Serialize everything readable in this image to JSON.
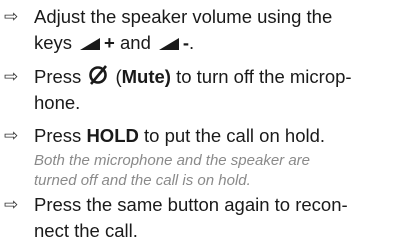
{
  "steps": [
    {
      "arrow": "⇨",
      "line1": "Adjust the speaker volume using the",
      "keys_prefix": "keys",
      "key_plus": "+",
      "connector": "and",
      "key_minus": "-",
      "end": "."
    },
    {
      "arrow": "⇨",
      "prefix": "Press",
      "open_paren": "(",
      "key_label": "Mute)",
      "line1_tail": "to turn off the microp-",
      "line2": "hone."
    },
    {
      "arrow": "⇨",
      "prefix": "Press",
      "key_label": "HOLD",
      "suffix": "to put the call on hold.",
      "note_line1": "Both the microphone and the speaker are",
      "note_line2": "turned off and the call is on hold."
    },
    {
      "arrow": "⇨",
      "line1": "Press the same button again to recon-",
      "line2": "nect the call."
    }
  ],
  "icons": {
    "volume": "volume-wedge-icon",
    "mute": "mute-slashed-circle-icon"
  },
  "colors": {
    "text": "#1a1a1a",
    "note": "#8a8a8a"
  }
}
